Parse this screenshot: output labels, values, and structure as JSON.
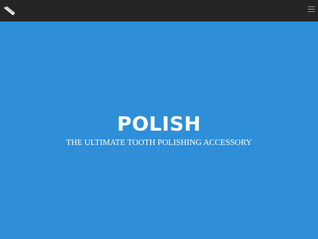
{
  "header": {
    "logo_icon": "diagonal-slash-logo",
    "menu_icon": "hamburger-menu-icon"
  },
  "hero": {
    "title": "POLISH",
    "tagline": "THE ULTIMATE TOOTH POLISHING ACCESSORY",
    "background_color": "#2e8fd8"
  },
  "colors": {
    "topbar": "#252525",
    "hero_background": "#2e8fd8",
    "text": "#ffffff"
  }
}
